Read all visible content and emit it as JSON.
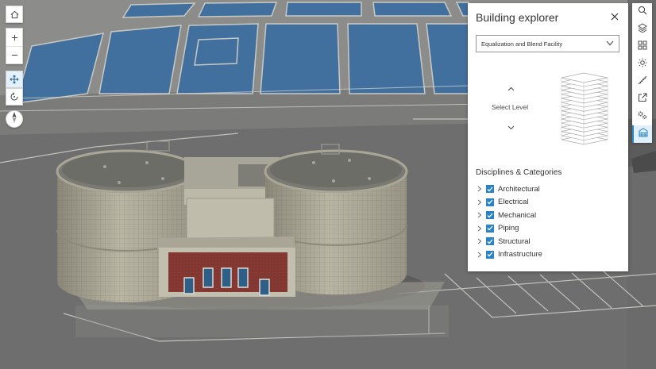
{
  "panel": {
    "title": "Building explorer",
    "facility": "Equalization and Blend Facility",
    "select_level": "Select Level",
    "section_title": "Disciplines & Categories",
    "categories": [
      {
        "label": "Architectural",
        "checked": true
      },
      {
        "label": "Electrical",
        "checked": true
      },
      {
        "label": "Mechanical",
        "checked": true
      },
      {
        "label": "Piping",
        "checked": true
      },
      {
        "label": "Structural",
        "checked": true
      },
      {
        "label": "Infrastructure",
        "checked": true
      }
    ]
  },
  "left_tools": [
    "home-icon",
    "zoom-in-icon",
    "zoom-out-icon",
    "pan-icon",
    "rotate-icon",
    "compass-icon"
  ],
  "action_bar": [
    "search-icon",
    "layers-icon",
    "basemap-icon",
    "daylight-icon",
    "measure-icon",
    "share-icon",
    "settings-icon",
    "building-explorer-icon"
  ],
  "colors": {
    "accent": "#2a82c7",
    "panel_bg": "#ffffff",
    "ground": "#6f7070",
    "basin_water": "#3f6fa6",
    "tank_wall": "#b8b4a3",
    "brick": "#8a3a36"
  }
}
